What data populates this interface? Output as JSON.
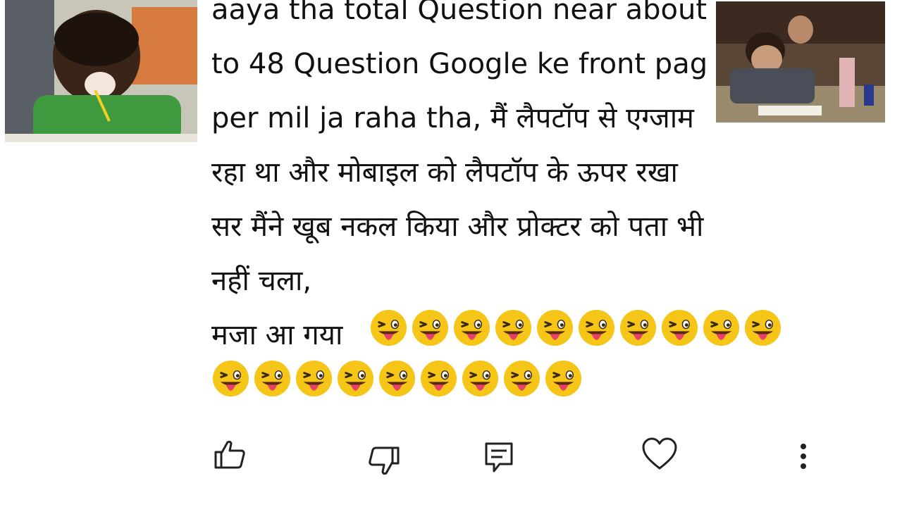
{
  "comment": {
    "lines": [
      "aaya tha total Question near about",
      "to 48 Question Google ke front pag",
      "per mil ja raha tha, मैं लैपटॉप से एग्जाम",
      "रहा था और मोबाइल को लैपटॉप के ऊपर रखा",
      "सर मैंने खूब नकल किया और प्रोक्टर को पता भी",
      "नहीं चला,",
      "मजा आ गया"
    ],
    "emoji_row1_count": 10,
    "emoji_row2_count": 9,
    "emoji_name": "winking-tongue-emoji"
  },
  "actions": {
    "like_icon": "thumbs-up-icon",
    "dislike_icon": "thumbs-down-icon",
    "reply_icon": "reply-icon",
    "heart_icon": "heart-icon",
    "more_icon": "more-vertical-icon"
  },
  "overlays": {
    "left": "kid-laughing-meme-image",
    "right": "exam-copying-meme-image"
  },
  "colors": {
    "text": "#111111",
    "emoji_face": "#f5c518",
    "emoji_tongue": "#e8406a",
    "icon": "#222222"
  }
}
